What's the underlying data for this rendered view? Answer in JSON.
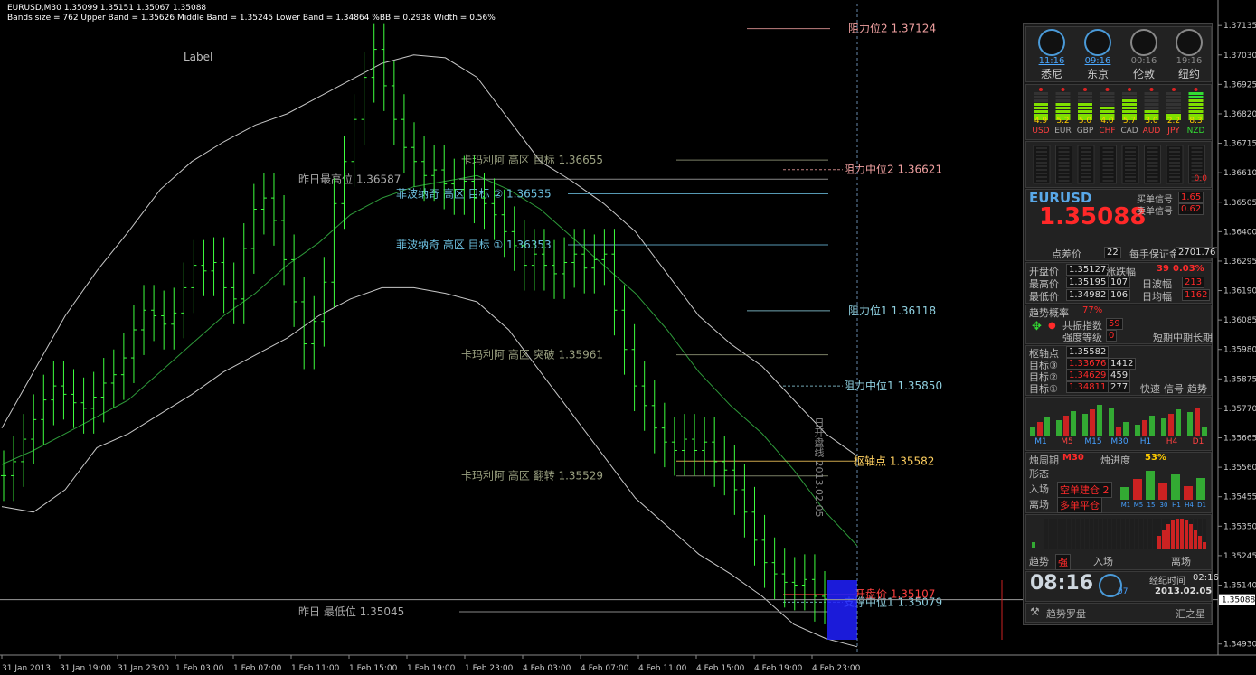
{
  "header": {
    "symbol_line": "EURUSD,M30  1.35099 1.35151 1.35067 1.35088",
    "bands_line": "Bands size = 762 Upper Band = 1.35626 Middle Band = 1.35245 Lower Band = 1.34864 %BB = 0.2938 Width = 0.56%",
    "label_text": "Label"
  },
  "chart_data": {
    "type": "ohlc",
    "symbol": "EURUSD",
    "timeframe": "M30",
    "ylim": [
      1.349,
      1.372
    ],
    "y_ticks": [
      "1.37135",
      "1.37030",
      "1.36925",
      "1.36820",
      "1.36715",
      "1.36610",
      "1.36505",
      "1.36400",
      "1.36295",
      "1.36190",
      "1.36085",
      "1.35980",
      "1.35875",
      "1.35770",
      "1.35665",
      "1.35560",
      "1.35455",
      "1.35350",
      "1.35245",
      "1.35140",
      "1.35088",
      "1.34930"
    ],
    "current_price": "1.35088",
    "x_ticks": [
      "31 Jan 2013",
      "31 Jan 19:00",
      "31 Jan 23:00",
      "1 Feb 03:00",
      "1 Feb 07:00",
      "1 Feb 11:00",
      "1 Feb 15:00",
      "1 Feb 19:00",
      "1 Feb 23:00",
      "4 Feb 03:00",
      "4 Feb 07:00",
      "4 Feb 11:00",
      "4 Feb 15:00",
      "4 Feb 19:00",
      "4 Feb 23:00"
    ],
    "closes": [
      1.3553,
      1.3558,
      1.3566,
      1.3573,
      1.358,
      1.3585,
      1.3582,
      1.3579,
      1.3577,
      1.3581,
      1.3586,
      1.3589,
      1.3595,
      1.3605,
      1.3612,
      1.361,
      1.3607,
      1.3611,
      1.362,
      1.3628,
      1.3626,
      1.3629,
      1.362,
      1.3616,
      1.3634,
      1.3648,
      1.3652,
      1.3644,
      1.363,
      1.3615,
      1.36,
      1.3608,
      1.3622,
      1.365,
      1.3665,
      1.368,
      1.3695,
      1.3705,
      1.3692,
      1.368,
      1.367,
      1.3665,
      1.366,
      1.3662,
      1.3657,
      1.3655,
      1.3658,
      1.3652,
      1.365,
      1.3646,
      1.364,
      1.3635,
      1.3628,
      1.3632,
      1.3628,
      1.3625,
      1.3629,
      1.3632,
      1.3627,
      1.363,
      1.3632,
      1.3612,
      1.3598,
      1.3585,
      1.3578,
      1.357,
      1.3565,
      1.3562,
      1.3566,
      1.3562,
      1.3565,
      1.3558,
      1.3555,
      1.3548,
      1.354,
      1.353,
      1.3522,
      1.3518,
      1.3515,
      1.3514,
      1.3516,
      1.351,
      1.3509
    ],
    "upper_band": [
      1.357,
      1.359,
      1.361,
      1.3626,
      1.364,
      1.3655,
      1.3665,
      1.3672,
      1.3678,
      1.3682,
      1.3688,
      1.3694,
      1.37,
      1.3703,
      1.3702,
      1.3695,
      1.368,
      1.3665,
      1.3658,
      1.365,
      1.364,
      1.3625,
      1.361,
      1.36,
      1.3592,
      1.358,
      1.3568,
      1.356
    ],
    "lower_band": [
      1.3542,
      1.354,
      1.3548,
      1.3563,
      1.3568,
      1.3575,
      1.3582,
      1.359,
      1.3596,
      1.3602,
      1.361,
      1.3616,
      1.362,
      1.362,
      1.3618,
      1.3615,
      1.3605,
      1.359,
      1.3575,
      1.356,
      1.3545,
      1.3535,
      1.3525,
      1.3518,
      1.351,
      1.35,
      1.3495,
      1.3492
    ],
    "middle_band": [
      1.3557,
      1.3562,
      1.3568,
      1.3574,
      1.358,
      1.359,
      1.36,
      1.361,
      1.3618,
      1.3628,
      1.3636,
      1.3646,
      1.3652,
      1.3656,
      1.3658,
      1.366,
      1.3655,
      1.3648,
      1.3638,
      1.3628,
      1.3618,
      1.3605,
      1.359,
      1.3578,
      1.3568,
      1.3555,
      1.354,
      1.3528
    ],
    "levels": [
      {
        "label": "阻力位2",
        "value": "1.37124",
        "v": 1.37124,
        "color": "#f0a0a0"
      },
      {
        "label": "卡玛利阿 高区 目标",
        "value": "1.36655",
        "v": 1.36655,
        "color": "#9aa080"
      },
      {
        "label": "阻力中位2",
        "value": "1.36621",
        "v": 1.36621,
        "color": "#f0a0a0"
      },
      {
        "label": "昨日最高位",
        "value": "1.36587",
        "v": 1.36587,
        "color": "#aaaaaa"
      },
      {
        "label": "菲波纳奇 高区 目标 ②",
        "value": "1.36535",
        "v": 1.36535,
        "color": "#6cc0e0"
      },
      {
        "label": "菲波纳奇 高区 目标 ①",
        "value": "1.36353",
        "v": 1.36353,
        "color": "#6cc0e0"
      },
      {
        "label": "阻力位1",
        "value": "1.36118",
        "v": 1.36118,
        "color": "#8fd0e0"
      },
      {
        "label": "卡玛利阿 高区 突破",
        "value": "1.35961",
        "v": 1.35961,
        "color": "#9aa080"
      },
      {
        "label": "阻力中位1",
        "value": "1.35850",
        "v": 1.3585,
        "color": "#8fd0e0"
      },
      {
        "label": "枢轴点",
        "value": "1.35582",
        "v": 1.35582,
        "color": "#ffd060"
      },
      {
        "label": "卡玛利阿 高区 翻转",
        "value": "1.35529",
        "v": 1.35529,
        "color": "#9aa080"
      },
      {
        "label": "开盘价",
        "value": "1.35107",
        "v": 1.35107,
        "color": "#ff4040"
      },
      {
        "label": "支撑中位1",
        "value": "1.35079",
        "v": 1.35079,
        "color": "#8fd0e0"
      },
      {
        "label": "昨日 最低位",
        "value": "1.35045",
        "v": 1.35045,
        "color": "#aaaaaa"
      }
    ],
    "date_line_label": "日开盘线 2013.02.05",
    "grid": false
  },
  "panel": {
    "clocks": [
      {
        "name": "悉尼",
        "time": "11:16",
        "active": true
      },
      {
        "name": "东京",
        "time": "09:16",
        "active": true
      },
      {
        "name": "伦敦",
        "time": "00:16",
        "active": false
      },
      {
        "name": "纽约",
        "time": "19:16",
        "active": false
      }
    ],
    "currencies": [
      {
        "code": "USD",
        "value": "4.9",
        "color": "#ff4040"
      },
      {
        "code": "EUR",
        "value": "5.2",
        "color": "#aaaaaa"
      },
      {
        "code": "GBP",
        "value": "5.0",
        "color": "#aaaaaa"
      },
      {
        "code": "CHF",
        "value": "4.0",
        "color": "#ff4040"
      },
      {
        "code": "CAD",
        "value": "5.7",
        "color": "#aaaaaa"
      },
      {
        "code": "AUD",
        "value": "3.0",
        "color": "#ff4040"
      },
      {
        "code": "JPY",
        "value": "2.2",
        "color": "#ff4040"
      },
      {
        "code": "NZD",
        "value": "8.3",
        "color": "#33dd33"
      }
    ],
    "strength_last": "0.0",
    "symbol": "EURUSD",
    "price": "1.35088",
    "buy_signal_label": "买单信号",
    "buy_signal": "1.65",
    "sell_signal_label": "卖单信号",
    "sell_signal": "0.62",
    "spread_label": "点差价",
    "spread": "22",
    "margin_label": "每手保证金",
    "margin": "2701.76",
    "open_label": "开盘价",
    "open": "1.35127",
    "change_label": "涨跌幅",
    "change_pts": "39",
    "change_pct": "0.03%",
    "high_label": "最高价",
    "high": "1.35195",
    "high_pts": "107",
    "range_label": "日波幅",
    "range": "213",
    "low_label": "最低价",
    "low": "1.34982",
    "low_pts": "106",
    "avg_label": "日均幅",
    "avg": "1162",
    "trend_prob_label": "趋势概率",
    "trend_prob": "77%",
    "resonance_label": "共振指数",
    "resonance": "59",
    "strength_label": "强度等级",
    "strength": "0",
    "short_label": "短期",
    "mid_label": "中期",
    "long_label": "长期",
    "pivot_label": "枢轴点",
    "pivot": "1.35582",
    "target3_label": "目标③",
    "target3": "1.33676",
    "target3_pts": "1412",
    "target2_label": "目标②",
    "target2": "1.34629",
    "target2_pts": "459",
    "target1_label": "目标①",
    "target1": "1.34811",
    "target1_pts": "277",
    "fast_label": "快速",
    "signal_label": "信号",
    "trend_label": "趋势",
    "timeframes": [
      "M1",
      "M5",
      "M15",
      "M30",
      "H1",
      "H4",
      "D1"
    ],
    "candle_period_label": "烛周期",
    "candle_period": "M30",
    "candle_progress_label": "烛进度",
    "candle_progress": "53%",
    "shape_label": "形态",
    "entry_label": "入场",
    "entry_value": "空单建仓 2",
    "exit_label": "离场",
    "exit_value": "多单平仓",
    "mini_tfs": [
      "M1",
      "M5",
      "15",
      "30",
      "H1",
      "H4",
      "D1"
    ],
    "trend_word_label": "趋势",
    "trend_word": "强",
    "entry2_label": "入场",
    "exit2_label": "离场",
    "clock_time": "08:16",
    "elapsed_label": "经纪时间",
    "elapsed": "02:16",
    "week": "07",
    "date": "2013.02.05",
    "footer_left": "趋势罗盘",
    "footer_right": "汇之星"
  }
}
